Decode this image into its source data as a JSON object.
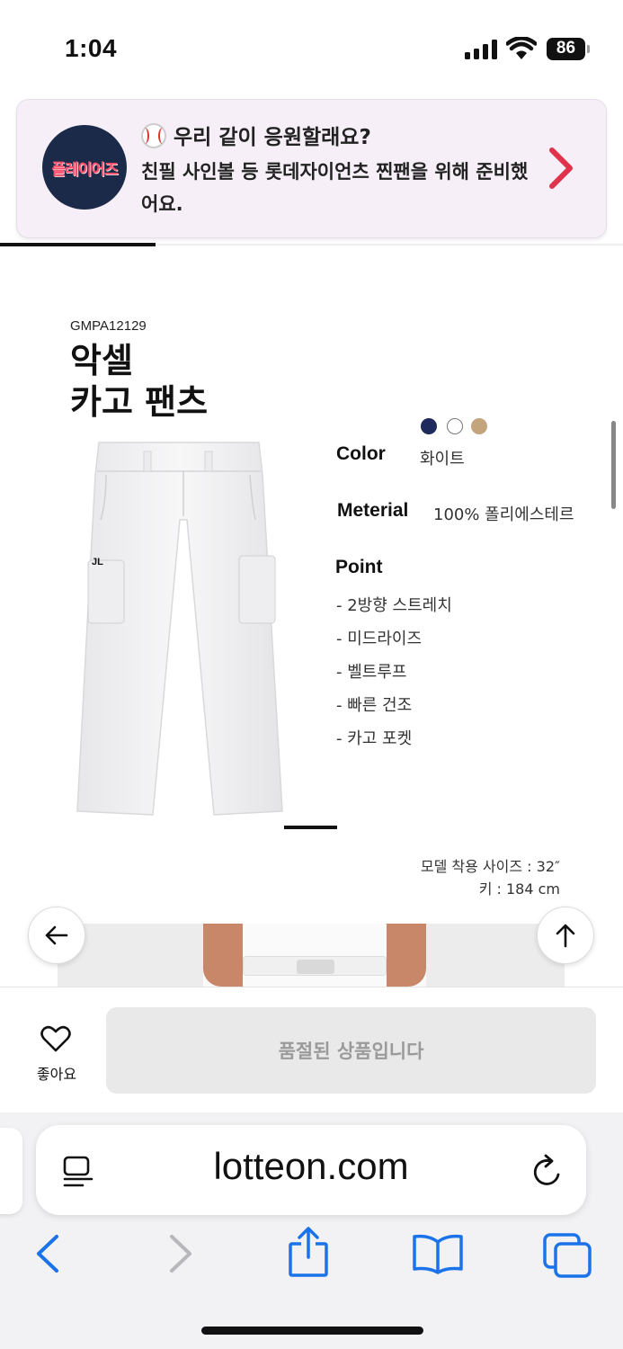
{
  "status_bar": {
    "time": "1:04",
    "battery": "86",
    "icons": [
      "signal-icon",
      "wifi-icon",
      "battery-icon"
    ]
  },
  "promo": {
    "logo_text": "플레이어즈",
    "title": "우리 같이 응원할래요?",
    "body": "친필 사인볼 등 롯데자이언츠 찐팬을 위해 준비했어요.",
    "accent": "#e0324a"
  },
  "product": {
    "code": "GMPA12129",
    "name_line1": "악셀",
    "name_line2": "카고 팬츠",
    "swatches": [
      "#1f2a5c",
      "#ffffff",
      "#c4a47c"
    ],
    "color_label": "Color",
    "color_value": "화이트",
    "material_label": "Meterial",
    "material_value": "100% 폴리에스테르",
    "point_label": "Point",
    "points": [
      "- 2방향 스트레치",
      "- 미드라이즈",
      "- 벨트루프",
      "- 빠른 건조",
      "- 카고 포켓"
    ],
    "model_size": "모델 착용 사이즈 : 32″",
    "model_height": "키 : 184 cm"
  },
  "purchase_bar": {
    "like_label": "좋아요",
    "soldout_label": "품절된 상품입니다"
  },
  "browser": {
    "url": "lotteon.com"
  }
}
